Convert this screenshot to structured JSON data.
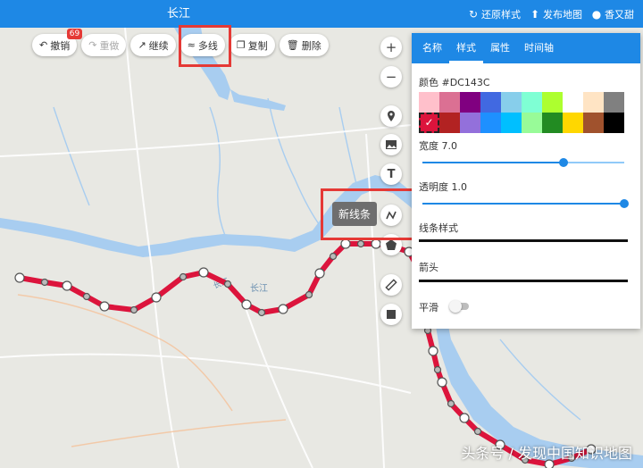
{
  "header": {
    "title": "长江",
    "restore_style": "还原样式",
    "publish_map": "发布地图",
    "user_name": "香又甜"
  },
  "toolbar": {
    "undo": "撤销",
    "undo_count": "69",
    "redo": "重做",
    "continue": "继续",
    "multiline": "多线",
    "copy": "复制",
    "delete": "删除"
  },
  "map": {
    "label_river": "长江",
    "label_small": "长江"
  },
  "tooltip": "新线条",
  "panel": {
    "tabs": [
      "名称",
      "样式",
      "属性",
      "时间轴"
    ],
    "active_tab": 1,
    "color_label": "颜色 #DC143C",
    "width_label": "宽度 7.0",
    "width_value": 0.7,
    "opacity_label": "透明度 1.0",
    "opacity_value": 1.0,
    "line_style_label": "线条样式",
    "arrow_label": "箭头",
    "smooth_label": "平滑",
    "colors": [
      "#ffc0cb",
      "#db7093",
      "#800080",
      "#4169e1",
      "#87ceeb",
      "#7fffd4",
      "#adff2f",
      "#ffffff",
      "#ffe4c4",
      "#808080",
      "#dc143c",
      "#b22222",
      "#9370db",
      "#1e90ff",
      "#00bfff",
      "#98fb98",
      "#228b22",
      "#ffd700",
      "#a0522d",
      "#000000"
    ],
    "selected_color": 10
  },
  "watermark": "头条号 / 发现中国知识地图",
  "accent": "#1e88e5",
  "line_color": "#dc143c"
}
